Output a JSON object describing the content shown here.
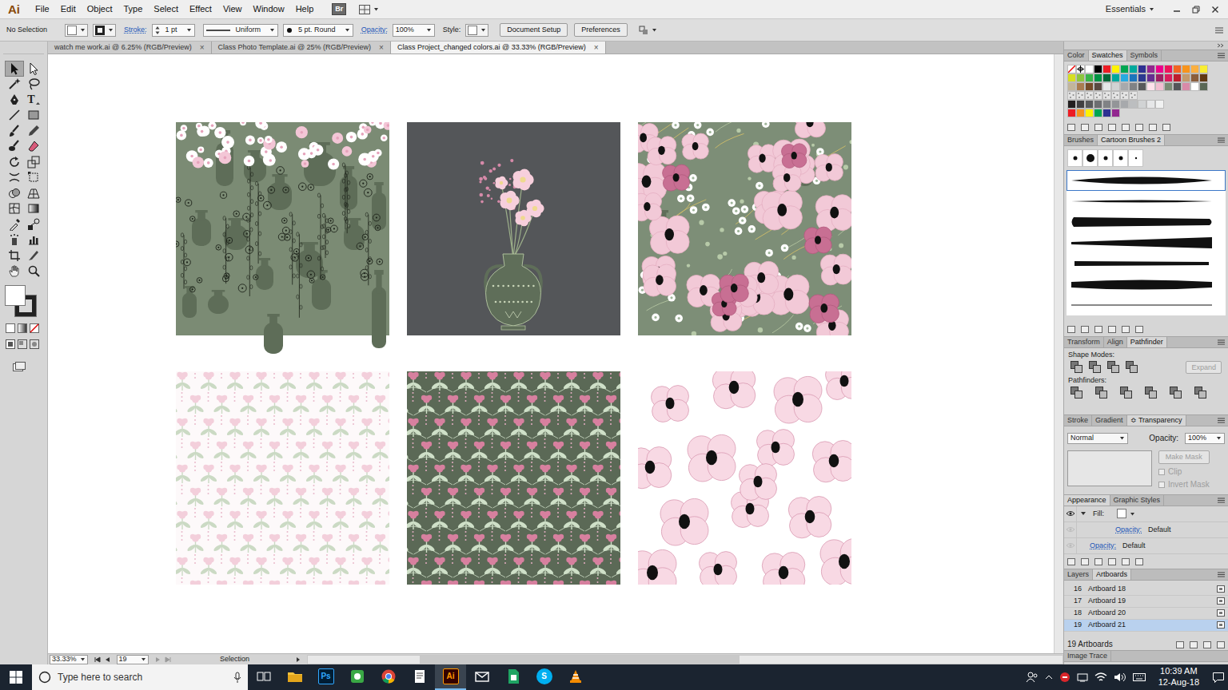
{
  "app": {
    "logo": "Ai",
    "bridge": "Br"
  },
  "menu": [
    "File",
    "Edit",
    "Object",
    "Type",
    "Select",
    "Effect",
    "View",
    "Window",
    "Help"
  ],
  "workspace": "Essentials",
  "control_bar": {
    "selection": "No Selection",
    "stroke_label": "Stroke:",
    "stroke_weight": "1 pt",
    "profile": "Uniform",
    "brush": "5 pt. Round",
    "opacity_label": "Opacity:",
    "opacity": "100%",
    "style_label": "Style:",
    "buttons": [
      "Document Setup",
      "Preferences"
    ]
  },
  "doc_tabs": [
    {
      "label": "watch me work.ai @ 6.25% (RGB/Preview)",
      "close": "×",
      "selected": false
    },
    {
      "label": "Class Photo Template.ai @ 25% (RGB/Preview)",
      "close": "×",
      "selected": false
    },
    {
      "label": "Class Project_changed colors.ai @ 33.33% (RGB/Preview)",
      "close": "×",
      "selected": true
    }
  ],
  "tools": [
    {
      "kind": "select",
      "selected": true
    },
    {
      "kind": "direct",
      "selected": false
    },
    {
      "kind": "magic",
      "selected": false
    },
    {
      "kind": "lasso",
      "selected": false
    },
    {
      "kind": "pen",
      "selected": false
    },
    {
      "kind": "type",
      "label": "T",
      "selected": false
    },
    {
      "kind": "line",
      "selected": false
    },
    {
      "kind": "rect",
      "selected": false
    },
    {
      "kind": "brush",
      "selected": false
    },
    {
      "kind": "pencil",
      "selected": false
    },
    {
      "kind": "blob",
      "selected": false
    },
    {
      "kind": "eraser",
      "selected": false
    },
    {
      "kind": "rotate",
      "selected": false
    },
    {
      "kind": "scale",
      "selected": false
    },
    {
      "kind": "width",
      "selected": false
    },
    {
      "kind": "free",
      "selected": false
    },
    {
      "kind": "shapebuilder",
      "selected": false
    },
    {
      "kind": "perspective",
      "selected": false
    },
    {
      "kind": "mesh",
      "selected": false
    },
    {
      "kind": "gradient",
      "selected": false
    },
    {
      "kind": "eyedropper",
      "selected": false
    },
    {
      "kind": "blend",
      "selected": false
    },
    {
      "kind": "symbol",
      "selected": false
    },
    {
      "kind": "graph",
      "selected": false
    },
    {
      "kind": "artboard",
      "selected": false
    },
    {
      "kind": "slice",
      "selected": false
    },
    {
      "kind": "hand",
      "selected": false
    },
    {
      "kind": "zoom",
      "selected": false
    }
  ],
  "artboards": [
    {
      "kind": "vases"
    },
    {
      "kind": "bouquet"
    },
    {
      "kind": "meadow"
    },
    {
      "kind": "trellis"
    },
    {
      "kind": "tulips"
    },
    {
      "kind": "poppies"
    }
  ],
  "status_bar": {
    "zoom": "33.33%",
    "artboard": "19",
    "tool": "Selection"
  },
  "panels": {
    "swatches": {
      "tabs": [
        {
          "label": "Color",
          "selected": false
        },
        {
          "label": "Swatches",
          "selected": true
        },
        {
          "label": "Symbols",
          "selected": false
        }
      ],
      "rows": [
        [
          {
            "kind": "none",
            "color": "#ffffff"
          },
          {
            "kind": "registration",
            "color": "#000000"
          },
          {
            "kind": "color",
            "color": "#ffffff"
          },
          {
            "kind": "color",
            "color": "#000000"
          },
          {
            "kind": "color",
            "color": "#ed1c24"
          },
          {
            "kind": "color",
            "color": "#fff200"
          },
          {
            "kind": "color",
            "color": "#00a651"
          },
          {
            "kind": "color",
            "color": "#00a99d"
          },
          {
            "kind": "color",
            "color": "#2e3192"
          },
          {
            "kind": "color",
            "color": "#92278f"
          },
          {
            "kind": "color",
            "color": "#ec008c"
          },
          {
            "kind": "color",
            "color": "#ed145b"
          },
          {
            "kind": "color",
            "color": "#f26522"
          },
          {
            "kind": "color",
            "color": "#f7941d"
          },
          {
            "kind": "color",
            "color": "#fbb040"
          },
          {
            "kind": "color",
            "color": "#f9ed32"
          }
        ],
        [
          {
            "kind": "color",
            "color": "#d7df23"
          },
          {
            "kind": "color",
            "color": "#8dc63f"
          },
          {
            "kind": "color",
            "color": "#39b54a"
          },
          {
            "kind": "color",
            "color": "#009444"
          },
          {
            "kind": "color",
            "color": "#006838"
          },
          {
            "kind": "color",
            "color": "#00a79d"
          },
          {
            "kind": "color",
            "color": "#27aae1"
          },
          {
            "kind": "color",
            "color": "#1c75bc"
          },
          {
            "kind": "color",
            "color": "#2b3990"
          },
          {
            "kind": "color",
            "color": "#662d91"
          },
          {
            "kind": "color",
            "color": "#9e1f63"
          },
          {
            "kind": "color",
            "color": "#da1c5c"
          },
          {
            "kind": "color",
            "color": "#be1e2d"
          },
          {
            "kind": "color",
            "color": "#c49a6c"
          },
          {
            "kind": "color",
            "color": "#8b5e3c"
          },
          {
            "kind": "color",
            "color": "#603913"
          }
        ],
        [
          {
            "kind": "color",
            "color": "#c2b59b"
          },
          {
            "kind": "color",
            "color": "#a97c50"
          },
          {
            "kind": "color",
            "color": "#754c29"
          },
          {
            "kind": "color",
            "color": "#594a42"
          },
          {
            "kind": "color",
            "color": "#e6e7e8"
          },
          {
            "kind": "color",
            "color": "#d1d3d4"
          },
          {
            "kind": "color",
            "color": "#a7a9ac"
          },
          {
            "kind": "color",
            "color": "#808285"
          },
          {
            "kind": "color",
            "color": "#58595b"
          },
          {
            "kind": "color",
            "color": "#ffe2ec"
          },
          {
            "kind": "color",
            "color": "#f2bfd1"
          },
          {
            "kind": "color",
            "color": "#7b8b74"
          },
          {
            "kind": "color",
            "color": "#545659"
          },
          {
            "kind": "color",
            "color": "#d98aa8"
          },
          {
            "kind": "color",
            "color": "#ffffff"
          },
          {
            "kind": "color",
            "color": "#5a6855"
          }
        ],
        [
          {
            "kind": "pattern",
            "color": "#e4e4e4"
          },
          {
            "kind": "pattern",
            "color": "#e4e4e4"
          },
          {
            "kind": "pattern",
            "color": "#e4e4e4"
          },
          {
            "kind": "pattern",
            "color": "#e4e4e4"
          },
          {
            "kind": "pattern",
            "color": "#e4e4e4"
          },
          {
            "kind": "pattern",
            "color": "#e4e4e4"
          },
          {
            "kind": "pattern",
            "color": "#e4e4e4"
          },
          {
            "kind": "pattern",
            "color": "#e4e4e4"
          }
        ],
        [
          {
            "kind": "color",
            "color": "#231f20"
          },
          {
            "kind": "color",
            "color": "#414042"
          },
          {
            "kind": "color",
            "color": "#58595b"
          },
          {
            "kind": "color",
            "color": "#6d6e71"
          },
          {
            "kind": "color",
            "color": "#808285"
          },
          {
            "kind": "color",
            "color": "#939598"
          },
          {
            "kind": "color",
            "color": "#a7a9ac"
          },
          {
            "kind": "color",
            "color": "#bcbec0"
          },
          {
            "kind": "color",
            "color": "#d1d3d4"
          },
          {
            "kind": "color",
            "color": "#e6e7e8"
          },
          {
            "kind": "color",
            "color": "#f1f2f2"
          }
        ],
        [
          {
            "kind": "color",
            "color": "#ed1c24"
          },
          {
            "kind": "color",
            "color": "#f7941d"
          },
          {
            "kind": "color",
            "color": "#fff200"
          },
          {
            "kind": "color",
            "color": "#00a651"
          },
          {
            "kind": "color",
            "color": "#2e3192"
          },
          {
            "kind": "color",
            "color": "#92278f"
          }
        ]
      ]
    },
    "brushes": {
      "tabs": [
        {
          "label": "Brushes",
          "selected": false
        },
        {
          "label": "Cartoon Brushes 2",
          "selected": true
        }
      ],
      "items": [
        {
          "kind": "dot",
          "selected": false
        },
        {
          "kind": "blob",
          "selected": false
        },
        {
          "kind": "dot",
          "selected": false
        },
        {
          "kind": "dot",
          "selected": false
        },
        {
          "kind": "speck",
          "selected": false
        },
        {
          "kind": "taper",
          "selected": true
        },
        {
          "kind": "thin",
          "selected": false
        },
        {
          "kind": "wedge",
          "selected": false
        },
        {
          "kind": "fan",
          "selected": false
        },
        {
          "kind": "bar",
          "selected": false
        },
        {
          "kind": "bulge",
          "selected": false
        },
        {
          "kind": "hair",
          "selected": false
        }
      ]
    },
    "pathfinder": {
      "tabs": [
        {
          "label": "Transform",
          "selected": false
        },
        {
          "label": "Align",
          "selected": false
        },
        {
          "label": "Pathfinder",
          "selected": true
        }
      ],
      "shape_modes_label": "Shape Modes:",
      "expand": {
        "label": "Expand",
        "disabled": true
      },
      "pathfinders_label": "Pathfinders:"
    },
    "transparency": {
      "tabs": [
        {
          "label": "Stroke",
          "selected": false
        },
        {
          "label": "Gradient",
          "selected": false
        },
        {
          "label": "≎ Transparency",
          "selected": true
        }
      ],
      "blend_mode": "Normal",
      "opacity_label": "Opacity:",
      "opacity": "100%",
      "make_mask": {
        "label": "Make Mask",
        "disabled": true
      },
      "options": [
        {
          "label": "Clip",
          "checked": false,
          "disabled": true
        },
        {
          "label": "Invert Mask",
          "checked": false,
          "disabled": true
        }
      ]
    },
    "appearance": {
      "tabs": [
        {
          "label": "Appearance",
          "selected": true
        },
        {
          "label": "Graphic Styles",
          "selected": false
        }
      ],
      "rows": [
        {
          "kind": "fill",
          "label": "Fill:",
          "visible": true,
          "expanded": true,
          "color": "#ffffff"
        },
        {
          "kind": "sub",
          "label": "Opacity:",
          "value": "Default",
          "visible": false
        },
        {
          "kind": "opacity",
          "label": "Opacity:",
          "value": "Default",
          "visible": false
        }
      ]
    },
    "artboards": {
      "tabs": [
        {
          "label": "Layers",
          "selected": false
        },
        {
          "label": "Artboards",
          "selected": true
        }
      ],
      "rows": [
        {
          "number": "16",
          "name": "Artboard 18",
          "selected": false
        },
        {
          "number": "17",
          "name": "Artboard 19",
          "selected": false
        },
        {
          "number": "18",
          "name": "Artboard 20",
          "selected": false
        },
        {
          "number": "19",
          "name": "Artboard 21",
          "selected": true
        }
      ],
      "count": "19 Artboards"
    },
    "image_trace": {
      "label": "Image Trace"
    }
  },
  "taskbar": {
    "search_placeholder": "Type here to search",
    "apps": [
      {
        "kind": "taskview",
        "selected": false
      },
      {
        "kind": "explorer",
        "selected": false
      },
      {
        "kind": "photoshop",
        "label": "Ps",
        "selected": false
      },
      {
        "kind": "camtasia",
        "selected": false
      },
      {
        "kind": "chrome",
        "selected": false
      },
      {
        "kind": "notes",
        "selected": false
      },
      {
        "kind": "illustrator",
        "label": "Ai",
        "selected": true
      },
      {
        "kind": "mail",
        "selected": false
      },
      {
        "kind": "sheets",
        "selected": false
      },
      {
        "kind": "skype",
        "label": "S",
        "selected": false
      },
      {
        "kind": "vlc",
        "selected": false
      }
    ],
    "time": "10:39 AM",
    "date": "12-Aug-18"
  }
}
